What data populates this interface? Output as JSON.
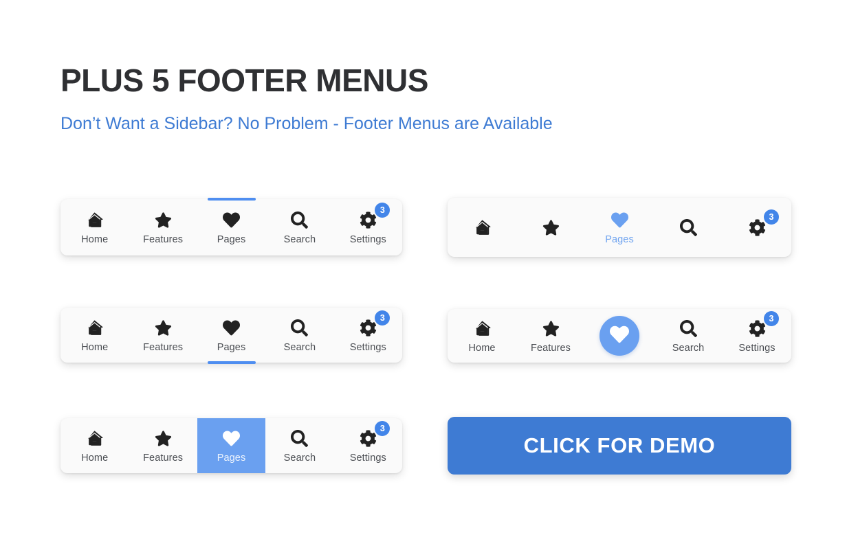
{
  "header": {
    "title": "PLUS 5 FOOTER MENUS",
    "subtitle": "Don’t Want a Sidebar? No Problem - Footer Menus are Available"
  },
  "colors": {
    "accent_blue": "#3e7bd3",
    "light_blue": "#6aa0f0",
    "indicator_blue": "#4f8ef0",
    "badge_blue": "#4285e9",
    "card_bg": "#fafafa",
    "icon_dark": "#222222",
    "label_gray": "#4a4d52",
    "heading_dark": "#2f3033"
  },
  "labels": {
    "home": "Home",
    "features": "Features",
    "pages": "Pages",
    "search": "Search",
    "settings": "Settings"
  },
  "icons": {
    "home": "home-icon",
    "features": "star-icon",
    "pages": "heart-icon",
    "search": "search-icon",
    "settings": "gear-icon"
  },
  "badge": {
    "count": "3"
  },
  "menus": [
    {
      "name": "footer-menu-top-indicator",
      "active": "Pages",
      "style": "top-indicator-bar",
      "items": [
        {
          "label": "Home",
          "icon": "home-icon",
          "badge": null,
          "active": false
        },
        {
          "label": "Features",
          "icon": "star-icon",
          "badge": null,
          "active": false
        },
        {
          "label": "Pages",
          "icon": "heart-icon",
          "badge": null,
          "active": true
        },
        {
          "label": "Search",
          "icon": "search-icon",
          "badge": null,
          "active": false
        },
        {
          "label": "Settings",
          "icon": "gear-icon",
          "badge": "3",
          "active": false
        }
      ]
    },
    {
      "name": "footer-menu-active-label-only",
      "active": "Pages",
      "style": "icons-only-active-label",
      "items": [
        {
          "label": "",
          "icon": "home-icon",
          "badge": null,
          "active": false
        },
        {
          "label": "",
          "icon": "star-icon",
          "badge": null,
          "active": false
        },
        {
          "label": "Pages",
          "icon": "heart-icon",
          "badge": null,
          "active": true
        },
        {
          "label": "",
          "icon": "search-icon",
          "badge": null,
          "active": false
        },
        {
          "label": "",
          "icon": "gear-icon",
          "badge": "3",
          "active": false
        }
      ]
    },
    {
      "name": "footer-menu-bottom-indicator",
      "active": "Pages",
      "style": "bottom-indicator-bar",
      "items": [
        {
          "label": "Home",
          "icon": "home-icon",
          "badge": null,
          "active": false
        },
        {
          "label": "Features",
          "icon": "star-icon",
          "badge": null,
          "active": false
        },
        {
          "label": "Pages",
          "icon": "heart-icon",
          "badge": null,
          "active": true
        },
        {
          "label": "Search",
          "icon": "search-icon",
          "badge": null,
          "active": false
        },
        {
          "label": "Settings",
          "icon": "gear-icon",
          "badge": "3",
          "active": false
        }
      ]
    },
    {
      "name": "footer-menu-circle-highlight",
      "active": "Pages",
      "style": "circle-fab-active",
      "items": [
        {
          "label": "Home",
          "icon": "home-icon",
          "badge": null,
          "active": false
        },
        {
          "label": "Features",
          "icon": "star-icon",
          "badge": null,
          "active": false
        },
        {
          "label": "",
          "icon": "heart-icon",
          "badge": null,
          "active": true
        },
        {
          "label": "Search",
          "icon": "search-icon",
          "badge": null,
          "active": false
        },
        {
          "label": "Settings",
          "icon": "gear-icon",
          "badge": "3",
          "active": false
        }
      ]
    },
    {
      "name": "footer-menu-block-highlight",
      "active": "Pages",
      "style": "filled-block-active",
      "items": [
        {
          "label": "Home",
          "icon": "home-icon",
          "badge": null,
          "active": false
        },
        {
          "label": "Features",
          "icon": "star-icon",
          "badge": null,
          "active": false
        },
        {
          "label": "Pages",
          "icon": "heart-icon",
          "badge": null,
          "active": true
        },
        {
          "label": "Search",
          "icon": "search-icon",
          "badge": null,
          "active": false
        },
        {
          "label": "Settings",
          "icon": "gear-icon",
          "badge": "3",
          "active": false
        }
      ]
    }
  ],
  "demo_button": {
    "label": "CLICK FOR DEMO"
  }
}
